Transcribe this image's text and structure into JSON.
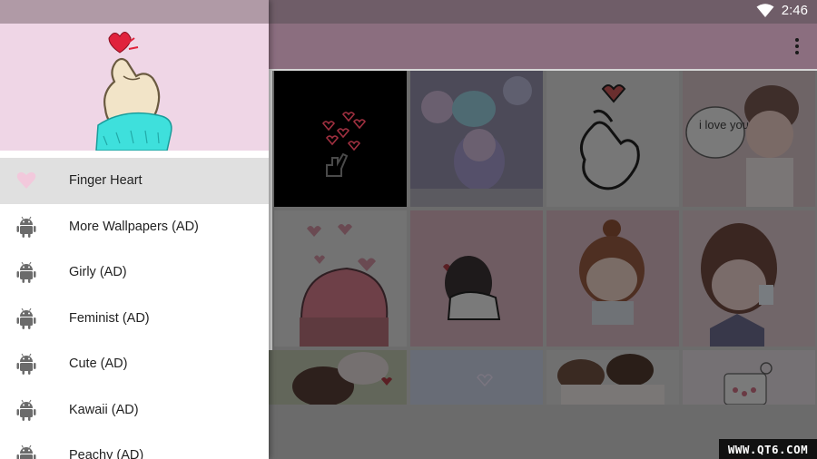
{
  "status_bar": {
    "time": "2:46",
    "wifi_icon": "wifi-icon"
  },
  "toolbar": {
    "overflow_icon": "more-vert-icon"
  },
  "drawer": {
    "header_image": "finger-heart-illustration",
    "items": [
      {
        "label": "Finger Heart",
        "icon": "heart-icon",
        "selected": true
      },
      {
        "label": "More Wallpapers (AD)",
        "icon": "android-icon"
      },
      {
        "label": "Girly (AD)",
        "icon": "android-icon"
      },
      {
        "label": "Feminist (AD)",
        "icon": "android-icon"
      },
      {
        "label": "Cute (AD)",
        "icon": "android-icon"
      },
      {
        "label": "Kawaii (AD)",
        "icon": "android-icon"
      },
      {
        "label": "Peachy (AD)",
        "icon": "android-icon"
      }
    ]
  },
  "gallery": {
    "tiles": [
      "black-finger-heart-wallpaper",
      "pastel-anime-girl-wallpaper",
      "finger-heart-sticker-wallpaper",
      "i-love-you-boy-wallpaper",
      "pink-hat-hearts-wallpaper",
      "hugging-couple-wallpaper",
      "chibi-girl-wallpaper",
      "girl-drinking-wallpaper",
      "cuddling-couple-wallpaper",
      "blue-pastel-heart-wallpaper",
      "sleeping-couple-wallpaper",
      "heart-jar-wallpaper"
    ],
    "bubble_text": "i love you!!"
  },
  "watermark": "WWW.QT6.COM"
}
